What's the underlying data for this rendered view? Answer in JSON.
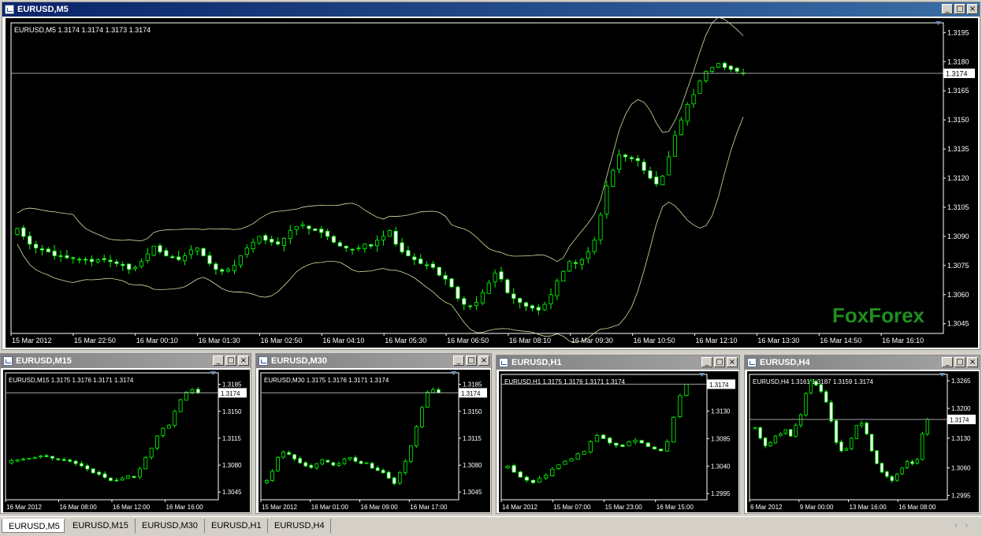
{
  "windows": [
    {
      "id": "m5",
      "title": "EURUSD,M5",
      "active": true,
      "info": "EURUSD,M5  1.3174 1.3174 1.3173 1.3174",
      "price_labels": [
        "1.3195",
        "1.3180",
        "1.3165",
        "1.3150",
        "1.3135",
        "1.3120",
        "1.3105",
        "1.3090",
        "1.3075",
        "1.3060",
        "1.3045"
      ],
      "current_price": "1.3174",
      "time_labels": [
        "15 Mar 2012",
        "15 Mar 22:50",
        "16 Mar 00:10",
        "16 Mar 01:30",
        "16 Mar 02:50",
        "16 Mar 04:10",
        "16 Mar 05:30",
        "16 Mar 06:50",
        "16 Mar 08:10",
        "16 Mar 09:30",
        "16 Mar 10:50",
        "16 Mar 12:10",
        "16 Mar 13:30",
        "16 Mar 14:50",
        "16 Mar 16:10"
      ],
      "watermark": "FoxForex"
    },
    {
      "id": "m15",
      "title": "EURUSD,M15",
      "active": false,
      "info": "EURUSD,M15  1.3175 1.3176 1.3171 1.3174",
      "price_labels": [
        "1.3185",
        "1.3150",
        "1.3115",
        "1.3080",
        "1.3045"
      ],
      "current_price": "1.3174",
      "time_labels": [
        "16 Mar 2012",
        "16 Mar 08:00",
        "16 Mar 12:00",
        "16 Mar 16:00"
      ]
    },
    {
      "id": "m30",
      "title": "EURUSD,M30",
      "active": false,
      "info": "EURUSD,M30  1.3175 1.3176 1.3171 1.3174",
      "price_labels": [
        "1.3185",
        "1.3150",
        "1.3115",
        "1.3080",
        "1.3045"
      ],
      "current_price": "1.3174",
      "time_labels": [
        "15 Mar 2012",
        "16 Mar 01:00",
        "16 Mar 09:00",
        "16 Mar 17:00"
      ]
    },
    {
      "id": "h1",
      "title": "EURUSD,H1",
      "active": false,
      "info": "EURUSD,H1  1.3175 1.3176 1.3171 1.3174",
      "price_labels": [
        "1.3175",
        "1.3130",
        "1.3085",
        "1.3040",
        "1.2995"
      ],
      "current_price": "1.3174",
      "time_labels": [
        "14 Mar 2012",
        "15 Mar 07:00",
        "15 Mar 23:00",
        "16 Mar 15:00"
      ]
    },
    {
      "id": "h4",
      "title": "EURUSD,H4",
      "active": false,
      "info": "EURUSD,H4  1.3161 1.3187 1.3159 1.3174",
      "price_labels": [
        "1.3265",
        "1.3200",
        "1.3130",
        "1.3060",
        "1.2995"
      ],
      "current_price": "1.3174",
      "time_labels": [
        "6 Mar 2012",
        "9 Mar 00:00",
        "13 Mar 16:00",
        "16 Mar 08:00"
      ]
    }
  ],
  "tabs": [
    "EURUSD,M5",
    "EURUSD,M15",
    "EURUSD,M30",
    "EURUSD,H1",
    "EURUSD,H4"
  ],
  "active_tab": 0,
  "colors": {
    "chart_bg": "#000000",
    "candle_bull": "#00ff00",
    "candle_bear": "#ffffff",
    "bands": "#c8e6a0",
    "watermark": "#1f8f1f",
    "axis_text": "#ffffff",
    "active_title": "#0a246a",
    "inactive_title": "#808080"
  },
  "chart_data": [
    {
      "type": "candlestick",
      "title": "EURUSD,M5",
      "ylim": [
        1.304,
        1.32
      ],
      "close": [
        1.3094,
        1.309,
        1.3086,
        1.3084,
        1.3083,
        1.3082,
        1.308,
        1.308,
        1.3079,
        1.3079,
        1.3078,
        1.3078,
        1.3077,
        1.3078,
        1.3078,
        1.3077,
        1.3076,
        1.3075,
        1.3073,
        1.3074,
        1.3077,
        1.3081,
        1.3085,
        1.3082,
        1.308,
        1.3079,
        1.3078,
        1.308,
        1.3083,
        1.3084,
        1.308,
        1.3076,
        1.3073,
        1.3072,
        1.3073,
        1.3075,
        1.308,
        1.3084,
        1.3087,
        1.309,
        1.3088,
        1.3087,
        1.3086,
        1.3089,
        1.3093,
        1.3095,
        1.3096,
        1.3094,
        1.3093,
        1.3092,
        1.309,
        1.3087,
        1.3085,
        1.3084,
        1.3083,
        1.3084,
        1.3086,
        1.3085,
        1.3088,
        1.309,
        1.3093,
        1.3086,
        1.3082,
        1.308,
        1.3078,
        1.3076,
        1.3075,
        1.3074,
        1.307,
        1.3068,
        1.3064,
        1.3058,
        1.3055,
        1.3054,
        1.3056,
        1.3061,
        1.3066,
        1.3071,
        1.3068,
        1.3061,
        1.3058,
        1.3056,
        1.3054,
        1.3053,
        1.3052,
        1.3055,
        1.306,
        1.3067,
        1.3072,
        1.3077,
        1.3076,
        1.3078,
        1.3082,
        1.3088,
        1.3101,
        1.3116,
        1.3124,
        1.3132,
        1.3131,
        1.313,
        1.3129,
        1.3124,
        1.312,
        1.3117,
        1.3121,
        1.3131,
        1.3142,
        1.315,
        1.3158,
        1.3163,
        1.317,
        1.3175,
        1.3177,
        1.3179,
        1.3177,
        1.3176,
        1.3175,
        1.3174
      ]
    },
    {
      "type": "candlestick",
      "title": "EURUSD,M15",
      "ylim": [
        1.3035,
        1.32
      ],
      "close": [
        1.3086,
        1.3087,
        1.3088,
        1.3089,
        1.309,
        1.3092,
        1.3091,
        1.3089,
        1.3087,
        1.3086,
        1.3085,
        1.3082,
        1.3079,
        1.3075,
        1.307,
        1.3068,
        1.3064,
        1.306,
        1.306,
        1.3063,
        1.3066,
        1.3064,
        1.3075,
        1.309,
        1.3102,
        1.3118,
        1.3128,
        1.3132,
        1.315,
        1.3165,
        1.3175,
        1.3178,
        1.3174
      ]
    },
    {
      "type": "candlestick",
      "title": "EURUSD,M30",
      "ylim": [
        1.3035,
        1.32
      ],
      "close": [
        1.306,
        1.3072,
        1.309,
        1.3097,
        1.3094,
        1.3088,
        1.3083,
        1.3079,
        1.3077,
        1.3082,
        1.3087,
        1.3084,
        1.308,
        1.3082,
        1.3088,
        1.309,
        1.3085,
        1.3082,
        1.3083,
        1.3076,
        1.3073,
        1.307,
        1.3063,
        1.3056,
        1.307,
        1.3085,
        1.3105,
        1.313,
        1.3155,
        1.3175,
        1.3178,
        1.3174
      ]
    },
    {
      "type": "candlestick",
      "title": "EURUSD,H1",
      "ylim": [
        1.2985,
        1.319
      ],
      "close": [
        1.304,
        1.303,
        1.3022,
        1.3017,
        1.3013,
        1.302,
        1.3025,
        1.3035,
        1.3042,
        1.3048,
        1.3052,
        1.306,
        1.3064,
        1.308,
        1.309,
        1.3085,
        1.3078,
        1.3074,
        1.3072,
        1.308,
        1.3082,
        1.3078,
        1.3072,
        1.3068,
        1.3065,
        1.308,
        1.312,
        1.3155,
        1.3174
      ]
    },
    {
      "type": "candlestick",
      "title": "EURUSD,H4",
      "ylim": [
        1.2985,
        1.328
      ],
      "close": [
        1.3155,
        1.313,
        1.3112,
        1.312,
        1.3135,
        1.314,
        1.315,
        1.3135,
        1.316,
        1.3185,
        1.3235,
        1.3265,
        1.3255,
        1.324,
        1.3215,
        1.317,
        1.312,
        1.31,
        1.3105,
        1.313,
        1.316,
        1.3165,
        1.314,
        1.31,
        1.307,
        1.305,
        1.304,
        1.303,
        1.3045,
        1.306,
        1.3075,
        1.307,
        1.308,
        1.314,
        1.3174
      ]
    }
  ]
}
